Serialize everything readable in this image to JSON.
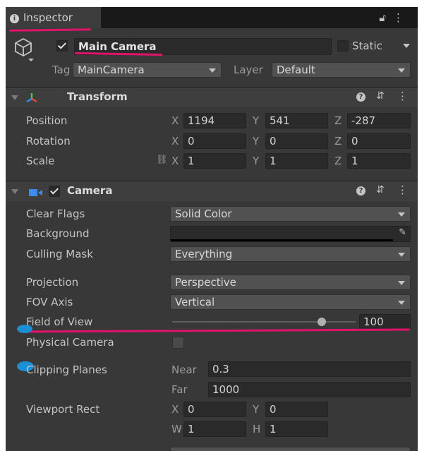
{
  "tab": {
    "title": "Inspector",
    "lock_icon": "lock-icon",
    "menu_icon": "kebab-menu-icon"
  },
  "gameobject": {
    "name": "Main Camera",
    "active": true,
    "static_label": "Static",
    "static": false,
    "tag_label": "Tag",
    "tag_value": "MainCamera",
    "layer_label": "Layer",
    "layer_value": "Default"
  },
  "transform": {
    "title": "Transform",
    "position_label": "Position",
    "position": {
      "x": "1194",
      "y": "541",
      "z": "-287"
    },
    "rotation_label": "Rotation",
    "rotation": {
      "x": "0",
      "y": "0",
      "z": "0"
    },
    "scale_label": "Scale",
    "scale": {
      "x": "1",
      "y": "1",
      "z": "1"
    },
    "axis": {
      "x": "X",
      "y": "Y",
      "z": "Z",
      "w": "W",
      "h": "H"
    }
  },
  "camera": {
    "title": "Camera",
    "enabled": true,
    "clear_flags_label": "Clear Flags",
    "clear_flags": "Solid Color",
    "background_label": "Background",
    "background_color": "#000000",
    "culling_mask_label": "Culling Mask",
    "culling_mask": "Everything",
    "projection_label": "Projection",
    "projection": "Perspective",
    "fov_axis_label": "FOV Axis",
    "fov_axis": "Vertical",
    "fov_label": "Field of View",
    "fov_value": "100",
    "fov_slider_fraction": 0.83,
    "physical_label": "Physical Camera",
    "physical": false,
    "clipping_label": "Clipping Planes",
    "near_label": "Near",
    "near": "0.3",
    "far_label": "Far",
    "far": "1000",
    "viewport_label": "Viewport Rect",
    "viewport": {
      "x": "0",
      "y": "0",
      "w": "1",
      "h": "1"
    }
  },
  "colors": {
    "annotation": "#e0136b",
    "marker": "#1a8fd6"
  }
}
